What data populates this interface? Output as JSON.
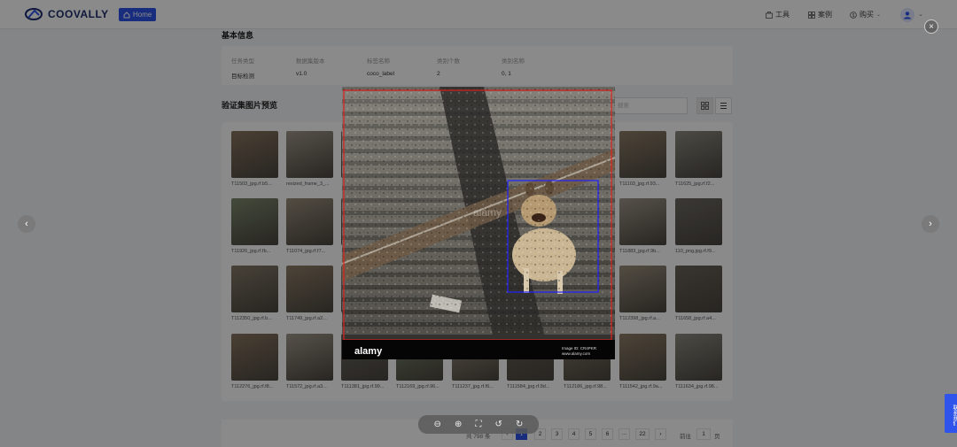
{
  "header": {
    "brand": "COOVALLY",
    "home_label": "Home",
    "nav": [
      {
        "label": "工具",
        "icon": "toolbox-icon"
      },
      {
        "label": "案例",
        "icon": "grid-icon"
      },
      {
        "label": "购买",
        "icon": "purchase-icon"
      }
    ]
  },
  "basic_info": {
    "title": "基本信息",
    "columns": [
      {
        "label": "任务类型",
        "value": "目标检测"
      },
      {
        "label": "数据集版本",
        "value": "v1.0"
      },
      {
        "label": "标签名称",
        "value": "coco_label"
      },
      {
        "label": "类别个数",
        "value": "2"
      },
      {
        "label": "类别名称",
        "value": "0, 1"
      }
    ]
  },
  "preview_section": {
    "title": "验证集图片预览",
    "search_placeholder": "搜索"
  },
  "thumbnails": [
    [
      "T11503_jpg.rf.b5...",
      "resized_frame_3_...",
      "",
      "",
      "",
      "",
      "",
      "T11103_jpg.rf.93...",
      "T11625_jpg.rf.f2..."
    ],
    [
      "T11926_jpg.rf.fb...",
      "T11074_jpg.rf.f7...",
      "",
      "",
      "",
      "",
      "",
      "T11883_jpg.rf.9b...",
      "110_png.jpg.rf.f9..."
    ],
    [
      "T112350_jpg.rf.b...",
      "T11749_jpg.rf.a2...",
      "",
      "",
      "",
      "",
      "",
      "T112398_jpg.rf.a...",
      "T11658_jpg.rf.a4..."
    ],
    [
      "T112276_jpg.rf.f8...",
      "T11572_jpg.rf.a3...",
      "T111381_jpg.rf.99...",
      "T112169_jpg.rf.96...",
      "T111237_jpg.rf.f6...",
      "T111584_jpg.rf.8d...",
      "T112186_jpg.rf.98...",
      "T111542_jpg.rf.9a...",
      "T111634_jpg.rf.98..."
    ]
  ],
  "pagination": {
    "total_label": "共 798 条",
    "pages": [
      "1",
      "2",
      "3",
      "4",
      "5",
      "6",
      "···",
      "22"
    ],
    "current": "1",
    "goto_label": "前往",
    "goto_value": "1",
    "page_suffix": "页"
  },
  "preview_image": {
    "watermark": "alamy",
    "footer_brand": "alamy",
    "footer_id": "Image ID: CR4PKR",
    "footer_url": "www.alamy.com",
    "box_colors": {
      "outer": "#e02020",
      "dog": "#2020ff"
    }
  },
  "contact_tab": "联系我们"
}
